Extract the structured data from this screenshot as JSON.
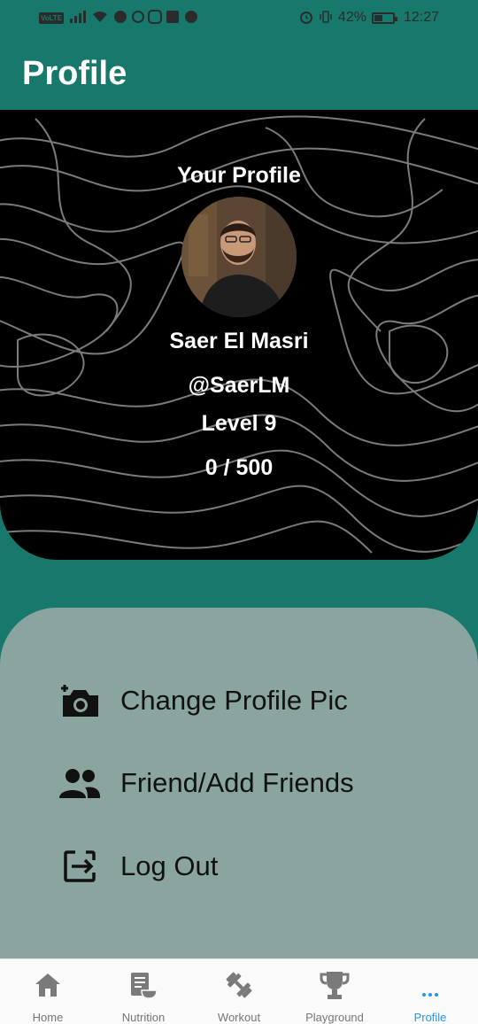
{
  "status_bar": {
    "left_icons": [
      "volte-icon",
      "signal-4g-icon",
      "wifi-icon",
      "notification-icons"
    ],
    "battery_percent": "42%",
    "time": "12:27"
  },
  "app_bar": {
    "title": "Profile"
  },
  "profile_card": {
    "heading": "Your Profile",
    "name": "Saer El Masri",
    "handle": "@SaerLM",
    "level": "Level 9",
    "xp": "0 / 500"
  },
  "menu": {
    "items": [
      {
        "label": "Change Profile Pic",
        "icon": "add-photo-icon"
      },
      {
        "label": "Friend/Add Friends",
        "icon": "people-icon"
      },
      {
        "label": "Log Out",
        "icon": "logout-icon"
      }
    ]
  },
  "bottom_nav": {
    "items": [
      {
        "label": "Home",
        "icon": "home-icon"
      },
      {
        "label": "Nutrition",
        "icon": "nutrition-icon"
      },
      {
        "label": "Workout",
        "icon": "dumbbell-icon"
      },
      {
        "label": "Playground",
        "icon": "trophy-icon"
      },
      {
        "label": "Profile",
        "icon": "more-icon",
        "active": true
      }
    ]
  },
  "colors": {
    "primary": "#17796b",
    "menu_panel": "#8aa5a0",
    "card_background": "#000000",
    "active_nav": "#2196f3",
    "inactive_nav": "#777777"
  }
}
